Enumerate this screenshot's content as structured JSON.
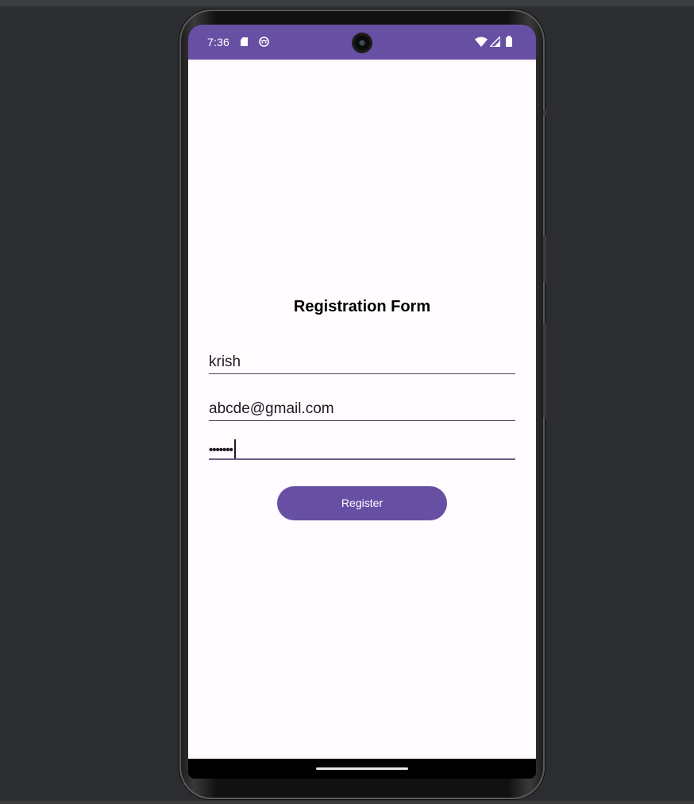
{
  "status_bar": {
    "time": "7:36",
    "icons": [
      "sd-card-icon",
      "face-icon",
      "camera-cutout",
      "wifi-icon",
      "signal-icon",
      "battery-icon"
    ],
    "color": "#6750a4"
  },
  "form": {
    "title": "Registration Form",
    "name_value": "krish",
    "email_value": "abcde@gmail.com",
    "password_value": "•••••••",
    "register_label": "Register",
    "accent_color": "#6750a4"
  },
  "nav": {
    "home_indicator": "home-indicator"
  }
}
